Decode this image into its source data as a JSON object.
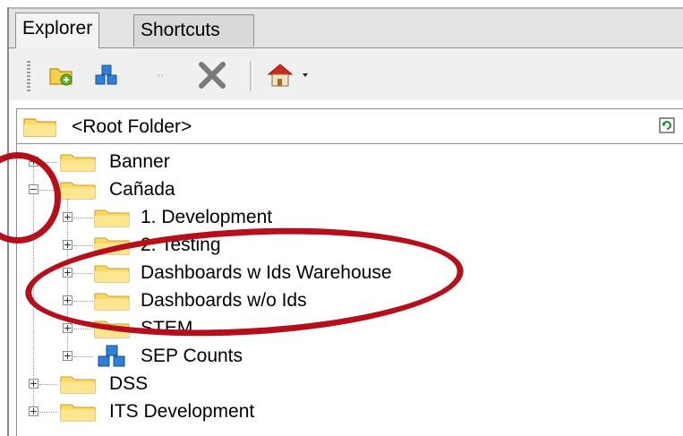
{
  "tabs": {
    "explorer": "Explorer",
    "shortcuts": "Shortcuts"
  },
  "toolbar": {
    "buttons": [
      {
        "icon": "new-folder-icon"
      },
      {
        "icon": "new-dashboard-icon"
      },
      {
        "icon": "small-disabled-icon"
      },
      {
        "icon": "delete-x-icon"
      },
      {
        "icon": "home-dropdown-icon"
      }
    ]
  },
  "path": {
    "label": "<Root Folder>",
    "refresh_icon": "refresh-icon"
  },
  "tree": {
    "banner": "Banner",
    "canada": "Cañada",
    "development1": "1. Development",
    "testing2": "2. Testing",
    "dash_warehouse": "Dashboards w Ids Warehouse",
    "dash_woids": "Dashboards w/o Ids",
    "stem": "STEM",
    "sep_counts": "SEP Counts",
    "dss": "DSS",
    "its_dev": "ITS Development"
  },
  "annotations": {
    "color": "#b40f1a"
  }
}
